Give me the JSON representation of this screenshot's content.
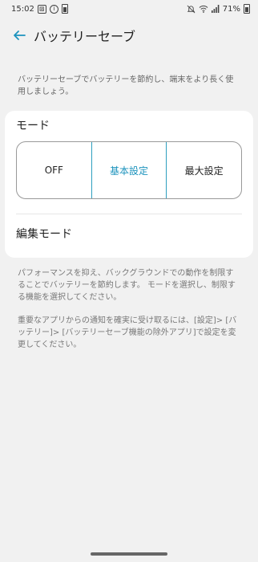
{
  "status_bar": {
    "time": "15:02",
    "battery_percent": "71%",
    "left_icons": [
      "image-icon",
      "info-icon",
      "battery-saver-icon"
    ],
    "right_icons": [
      "mute-icon",
      "wifi-icon",
      "signal-icon",
      "battery-icon"
    ]
  },
  "header": {
    "title": "バッテリーセーブ"
  },
  "description": "バッテリーセーブでバッテリーを節約し、端末をより長く使用しましょう。",
  "mode_card": {
    "title": "モード",
    "options": [
      {
        "label": "OFF",
        "selected": false
      },
      {
        "label": "基本設定",
        "selected": true
      },
      {
        "label": "最大設定",
        "selected": false
      }
    ],
    "edit_mode_label": "編集モード"
  },
  "info_text_1": "パフォーマンスを抑え、バックグラウンドでの動作を制限することでバッテリーを節約します。 モードを選択し、制限する機能を選択してください。",
  "info_text_2": "重要なアプリからの通知を確実に受け取るには、[設定]> [バッテリー]> [バッテリーセーブ機能の除外アプリ]で設定を変更してください。",
  "colors": {
    "accent": "#1c93bd",
    "background": "#f1f1f1",
    "card": "#ffffff"
  }
}
